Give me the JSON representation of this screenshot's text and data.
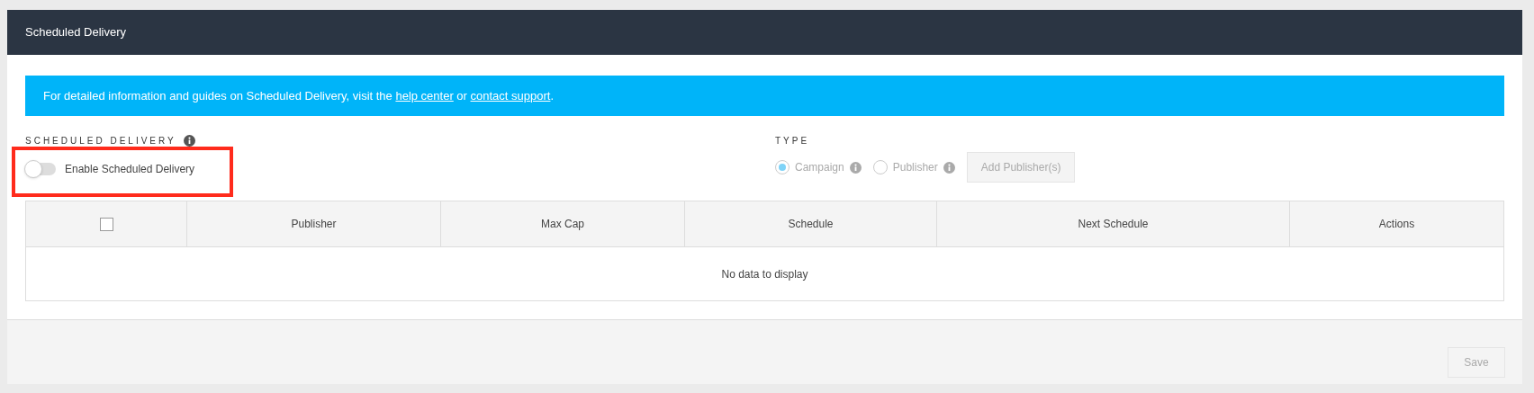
{
  "header": {
    "title": "Scheduled Delivery"
  },
  "banner": {
    "text": "For detailed information and guides on Scheduled Delivery, visit the ",
    "links": [
      "help center",
      "contact support"
    ],
    "between": " or ",
    "end": "."
  },
  "scheduled_delivery": {
    "label": "SCHEDULED DELIVERY",
    "toggle": {
      "label": "Enable Scheduled Delivery",
      "on": false
    }
  },
  "type": {
    "label": "TYPE",
    "options": [
      {
        "label": "Campaign",
        "selected": true,
        "disabled": true
      },
      {
        "label": "Publisher",
        "selected": false,
        "disabled": true
      }
    ],
    "button": {
      "label": "Add Publisher(s)",
      "disabled": true
    }
  },
  "table": {
    "select_all": {
      "checked": false
    },
    "columns": [
      "Publisher",
      "Max Cap",
      "Schedule",
      "Next Schedule",
      "Actions"
    ],
    "empty_text": "No data to display"
  },
  "footer": {
    "save": {
      "label": "Save",
      "disabled": true
    }
  }
}
